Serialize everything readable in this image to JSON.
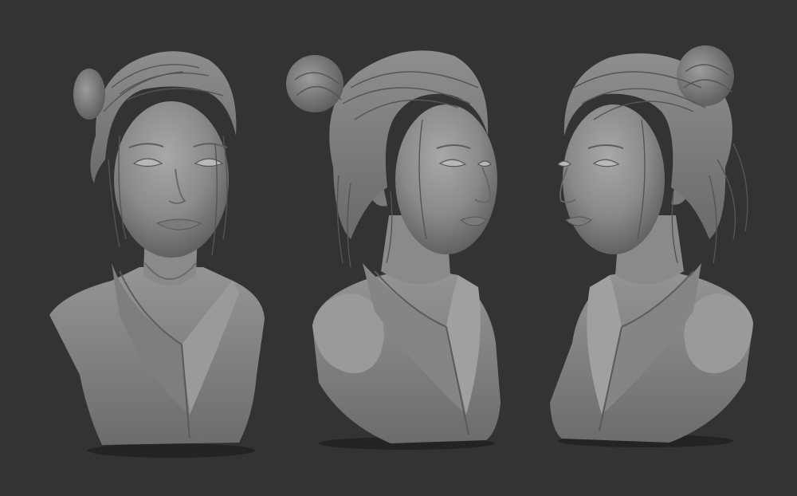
{
  "scene": {
    "background_color": "#333335",
    "clay_color": "#8c8c8c",
    "clay_light": "#a4a4a4",
    "clay_dark": "#5e5e5e",
    "shadow_color": "#1e1e1f",
    "views": [
      {
        "name": "front",
        "facing": "viewer"
      },
      {
        "name": "three-quarter-right",
        "facing": "right"
      },
      {
        "name": "three-quarter-left",
        "facing": "left"
      }
    ]
  }
}
